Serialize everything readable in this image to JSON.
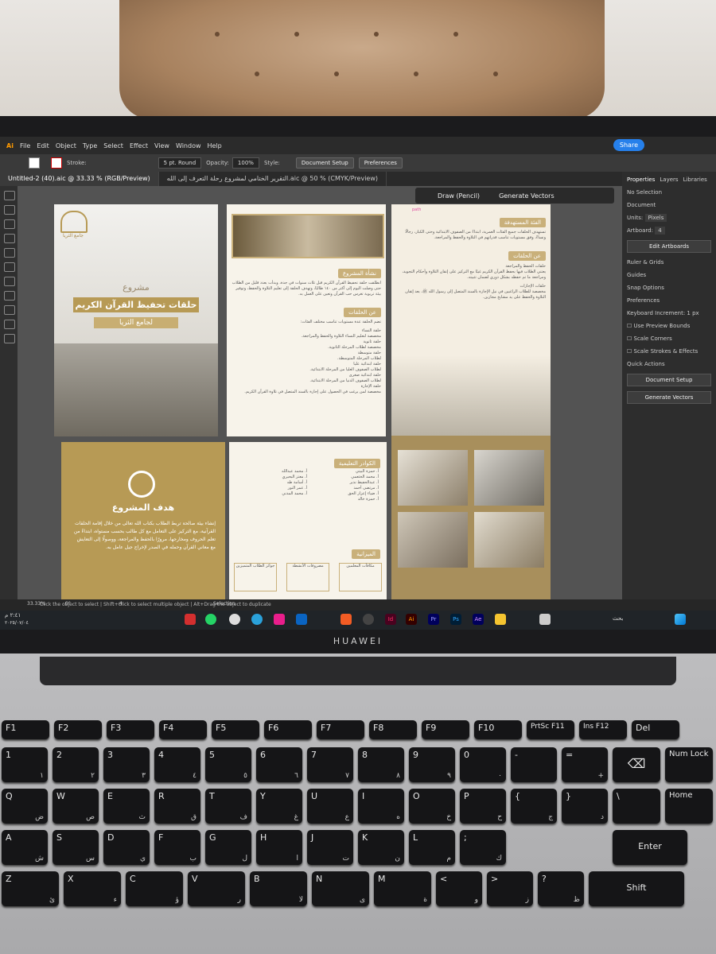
{
  "app": {
    "menus": [
      "File",
      "Edit",
      "Object",
      "Type",
      "Select",
      "Effect",
      "View",
      "Window",
      "Help"
    ],
    "share_label": "Share"
  },
  "control_bar": {
    "stroke_label": "Stroke:",
    "brush": "5 pt. Round",
    "opacity_label": "Opacity:",
    "opacity_value": "100%",
    "style_label": "Style:",
    "document_setup": "Document Setup",
    "preferences": "Preferences"
  },
  "tabs": [
    {
      "label": "Untitled-2 (40).aic @ 33.33 % (RGB/Preview)"
    },
    {
      "label": "التقرير الختامي لمشروع رحلة التعرف إلى الله.aic @ 50 % (CMYK/Preview)"
    }
  ],
  "context_bar": {
    "draw": "Draw (Pencil)",
    "generate": "Generate Vectors"
  },
  "document": {
    "page1": {
      "logo": "جامع الثريا",
      "kicker": "مشروع",
      "title": "حلقات تحفيظ القرآن الكريم",
      "subtitle": "لجامع الثريا"
    },
    "page2": {
      "h1": "نشأة المشروع",
      "p1": "انطلقت حلقة تحفيظ القرآن الكريم قبل ثلاث سنوات في جدة، وبدأت بعدد قليل من الطلاب حتى وصلت اليوم إلى أكثر من ١٤٠ طالبًا، وتهدف الحلقة إلى تعليم التلاوة والحفظ، وتوفير بيئة تربوية تغرس حب القرآن وتعين على العمل به.",
      "h2": "عن الحلقات",
      "intro": "تضم الحلقة عدة مستويات تناسب مختلف الفئات:",
      "items": [
        {
          "name": "حلقة النساء",
          "desc": "مخصصة لتعليم النساء التلاوة والحفظ والمراجعة."
        },
        {
          "name": "حلقة ثانوية",
          "desc": "مخصصة لطلاب المرحلة الثانوية."
        },
        {
          "name": "حلقة متوسطة",
          "desc": "لطلاب المرحلة المتوسطة."
        },
        {
          "name": "حلقة ابتدائية عليا",
          "desc": "لطلاب الصفوف العليا من المرحلة الابتدائية."
        },
        {
          "name": "حلقة ابتدائية صغرى",
          "desc": "لطلاب الصفوف الدنيا من المرحلة الابتدائية."
        },
        {
          "name": "حلقة الإجازة",
          "desc": "مخصصة لمن يرغب في الحصول على إجازة بالسند المتصل في تلاوة القرآن الكريم."
        }
      ]
    },
    "page3": {
      "path_label": "path",
      "h1": "الفئة المستهدفة",
      "p1": "تستهدف الحلقات جميع الفئات العمرية، ابتداءً من الصفوف الابتدائية وحتى الكبار، رجالًا ونساءً، وفق مستويات تناسب قدراتهم في التلاوة والحفظ والمراجعة.",
      "h2": "عن الحلقات",
      "sub1": "حلقات الحفظ والمراجعة",
      "sub1_text": "يعتني الطلاب فيها بحفظ القرآن الكريم غيبًا مع التركيز على إتقان التلاوة وأحكام التجويد، ومراجعة ما تم حفظه بشكل دوري لضمان تثبيته.",
      "sub2": "حلقات الإجازات",
      "sub2_text": "مخصصة للطلاب الراغبين في نيل الإجازة بالسند المتصل إلى رسول الله ﷺ، بعد إتقان التلاوة والحفظ على يد مشايخ مجازين."
    },
    "page4": {
      "title": "هدف المشروع",
      "text": "إنشاء بيئة صالحة تربط الطلاب بكتاب الله تعالى من خلال إقامة الحلقات القرآنية، مع التركيز على التعامل مع كل طالب بحسب مستواه، ابتداءً من تعلم الحروف ومخارجها، مرورًا بالحفظ والمراجعة، ووصولًا إلى التعايش مع معاني القرآن وحمله في الصدر لإخراج جيل عامل به."
    },
    "page5": {
      "h1": "الكوادر التعليمية",
      "col_right": [
        "أ. حمزة البيتي",
        "أ. محمد الخثعمي",
        "أ. عبدالحفيظ نذير",
        "أ. مرتضى أحمد",
        "أ. ضياء إعزاز الحق",
        "أ. حمزة خالد"
      ],
      "col_left": [
        "أ. محمد عبدالله",
        "أ. معتز البحيري",
        "أ. أسامة طه",
        "أ. عمر النور",
        "أ. محمد المدني"
      ],
      "h2": "الميزانية",
      "budget": [
        "مكافآت المعلمين",
        "مصروفات الأنشطة",
        "جوائز الطلاب المتميزين"
      ]
    }
  },
  "panel": {
    "tabs": [
      "Properties",
      "Layers",
      "Libraries"
    ],
    "no_selection": "No Selection",
    "document": "Document",
    "units_label": "Units:",
    "units_value": "Pixels",
    "artboard_label": "Artboard:",
    "artboard_value": "4",
    "edit_artboards": "Edit Artboards",
    "ruler_grids": "Ruler & Grids",
    "guides": "Guides",
    "snap_options": "Snap Options",
    "preferences": "Preferences",
    "keyboard_increment": "Keyboard Increment:",
    "keyboard_increment_value": "1 px",
    "cb1": "Use Preview Bounds",
    "cb2": "Scale Corners",
    "cb3": "Scale Strokes & Effects",
    "quick_actions": "Quick Actions",
    "doc_setup": "Document Setup",
    "gen_vectors": "Generate Vectors"
  },
  "status": {
    "zoom": "33.33%",
    "rotation": "0°",
    "artboard": "4",
    "mode": "Selection",
    "hint": "Click the object to select  |  Shift+Click to select multiple object  |  Alt+Drag the object to duplicate"
  },
  "taskbar": {
    "time": "٢:٤١ م",
    "date": "٢٠٢٥/٠٧/٠٤",
    "search": "بحث"
  },
  "laptop": {
    "brand": "HUAWEI"
  },
  "keyboard": {
    "row0": [
      "F1",
      "F2",
      "F3",
      "F4",
      "F5",
      "F6",
      "F7",
      "F8",
      "F9",
      "F10",
      "PrtSc F11",
      "Ins F12",
      "Del"
    ],
    "row1": [
      {
        "k": "1",
        "a": "١"
      },
      {
        "k": "2",
        "a": "٢"
      },
      {
        "k": "3",
        "a": "٣"
      },
      {
        "k": "4",
        "a": "٤"
      },
      {
        "k": "5",
        "a": "٥"
      },
      {
        "k": "6",
        "a": "٦"
      },
      {
        "k": "7",
        "a": "٧"
      },
      {
        "k": "8",
        "a": "٨"
      },
      {
        "k": "9",
        "a": "٩"
      },
      {
        "k": "0",
        "a": "٠"
      },
      {
        "k": "-",
        "a": ""
      },
      {
        "k": "=",
        "a": "+"
      }
    ],
    "row2": [
      {
        "k": "Q",
        "a": "ض"
      },
      {
        "k": "W",
        "a": "ص"
      },
      {
        "k": "E",
        "a": "ث"
      },
      {
        "k": "R",
        "a": "ق"
      },
      {
        "k": "T",
        "a": "ف"
      },
      {
        "k": "Y",
        "a": "غ"
      },
      {
        "k": "U",
        "a": "ع"
      },
      {
        "k": "I",
        "a": "ه"
      },
      {
        "k": "O",
        "a": "خ"
      },
      {
        "k": "P",
        "a": "ح"
      },
      {
        "k": "{",
        "a": "ج"
      },
      {
        "k": "}",
        "a": "د"
      },
      {
        "k": "\\",
        "a": ""
      }
    ],
    "row3": [
      {
        "k": "A",
        "a": "ش"
      },
      {
        "k": "S",
        "a": "س"
      },
      {
        "k": "D",
        "a": "ي"
      },
      {
        "k": "F",
        "a": "ب"
      },
      {
        "k": "G",
        "a": "ل"
      },
      {
        "k": "H",
        "a": "ا"
      },
      {
        "k": "J",
        "a": "ت"
      },
      {
        "k": "K",
        "a": "ن"
      },
      {
        "k": "L",
        "a": "م"
      },
      {
        "k": ";",
        "a": "ك"
      }
    ],
    "row4": [
      {
        "k": "Z",
        "a": "ئ"
      },
      {
        "k": "X",
        "a": "ء"
      },
      {
        "k": "C",
        "a": "ؤ"
      },
      {
        "k": "V",
        "a": "ر"
      },
      {
        "k": "B",
        "a": "لا"
      },
      {
        "k": "N",
        "a": "ى"
      },
      {
        "k": "M",
        "a": "ة"
      },
      {
        "k": "<",
        "a": "و"
      },
      {
        "k": ">",
        "a": "ز"
      },
      {
        "k": "?",
        "a": "ظ"
      }
    ],
    "backspace": "⌫",
    "enter": "Enter",
    "shift": "Shift",
    "numlock": "Num Lock",
    "home": "Home"
  },
  "colors": {
    "gold": "#b79a55",
    "panel": "#2d2d2d",
    "accent": "#2680eb"
  }
}
